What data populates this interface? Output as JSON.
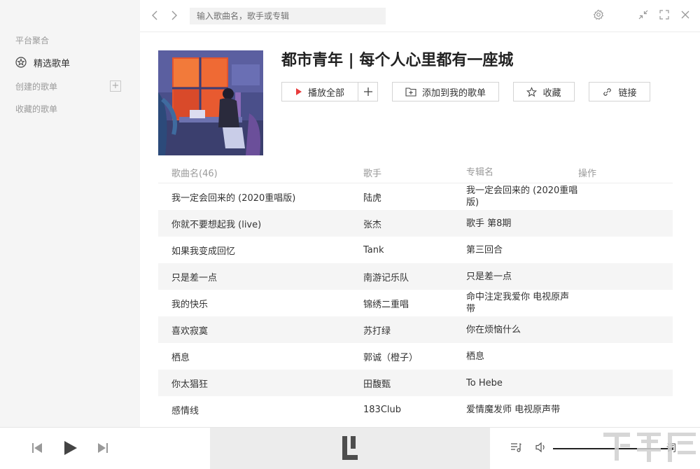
{
  "sidebar": {
    "section_platform": "平台聚合",
    "featured_label": "精选歌单",
    "section_created": "创建的歌单",
    "section_collected": "收藏的歌单"
  },
  "topbar": {
    "search_placeholder": "输入歌曲名，歌手或专辑"
  },
  "playlist": {
    "title": "都市青年 | 每个人心里都有一座城",
    "play_all_label": "播放全部",
    "add_to_my_label": "添加到我的歌单",
    "collect_label": "收藏",
    "link_label": "链接"
  },
  "table": {
    "headers": {
      "song": "歌曲名(46)",
      "artist": "歌手",
      "album": "专辑名",
      "action": "操作"
    },
    "rows": [
      {
        "song": "我一定会回来的 (2020重唱版)",
        "artist": "陆虎",
        "album": "我一定会回来的 (2020重唱版)"
      },
      {
        "song": "你就不要想起我 (live)",
        "artist": "张杰",
        "album": "歌手 第8期"
      },
      {
        "song": "如果我变成回忆",
        "artist": "Tank",
        "album": "第三回合"
      },
      {
        "song": "只是差一点",
        "artist": "南游记乐队",
        "album": "只是差一点"
      },
      {
        "song": "我的快乐",
        "artist": "锦绣二重唱",
        "album": "命中注定我爱你 电视原声带"
      },
      {
        "song": "喜欢寂寞",
        "artist": "苏打绿",
        "album": "你在烦恼什么"
      },
      {
        "song": "栖息",
        "artist": "郭诚（橙子）",
        "album": "栖息"
      },
      {
        "song": "你太猖狂",
        "artist": "田馥甄",
        "album": "To Hebe"
      },
      {
        "song": "感情线",
        "artist": "183Club",
        "album": "爱情魔发师 电视原声带"
      }
    ]
  },
  "player": {
    "lyric_label": "词",
    "volume": 0.7
  },
  "colors": {
    "accent_red": "#e83c3c",
    "sidebar_bg": "#f5f5f5",
    "row_alt_bg": "#f5f5f5"
  }
}
